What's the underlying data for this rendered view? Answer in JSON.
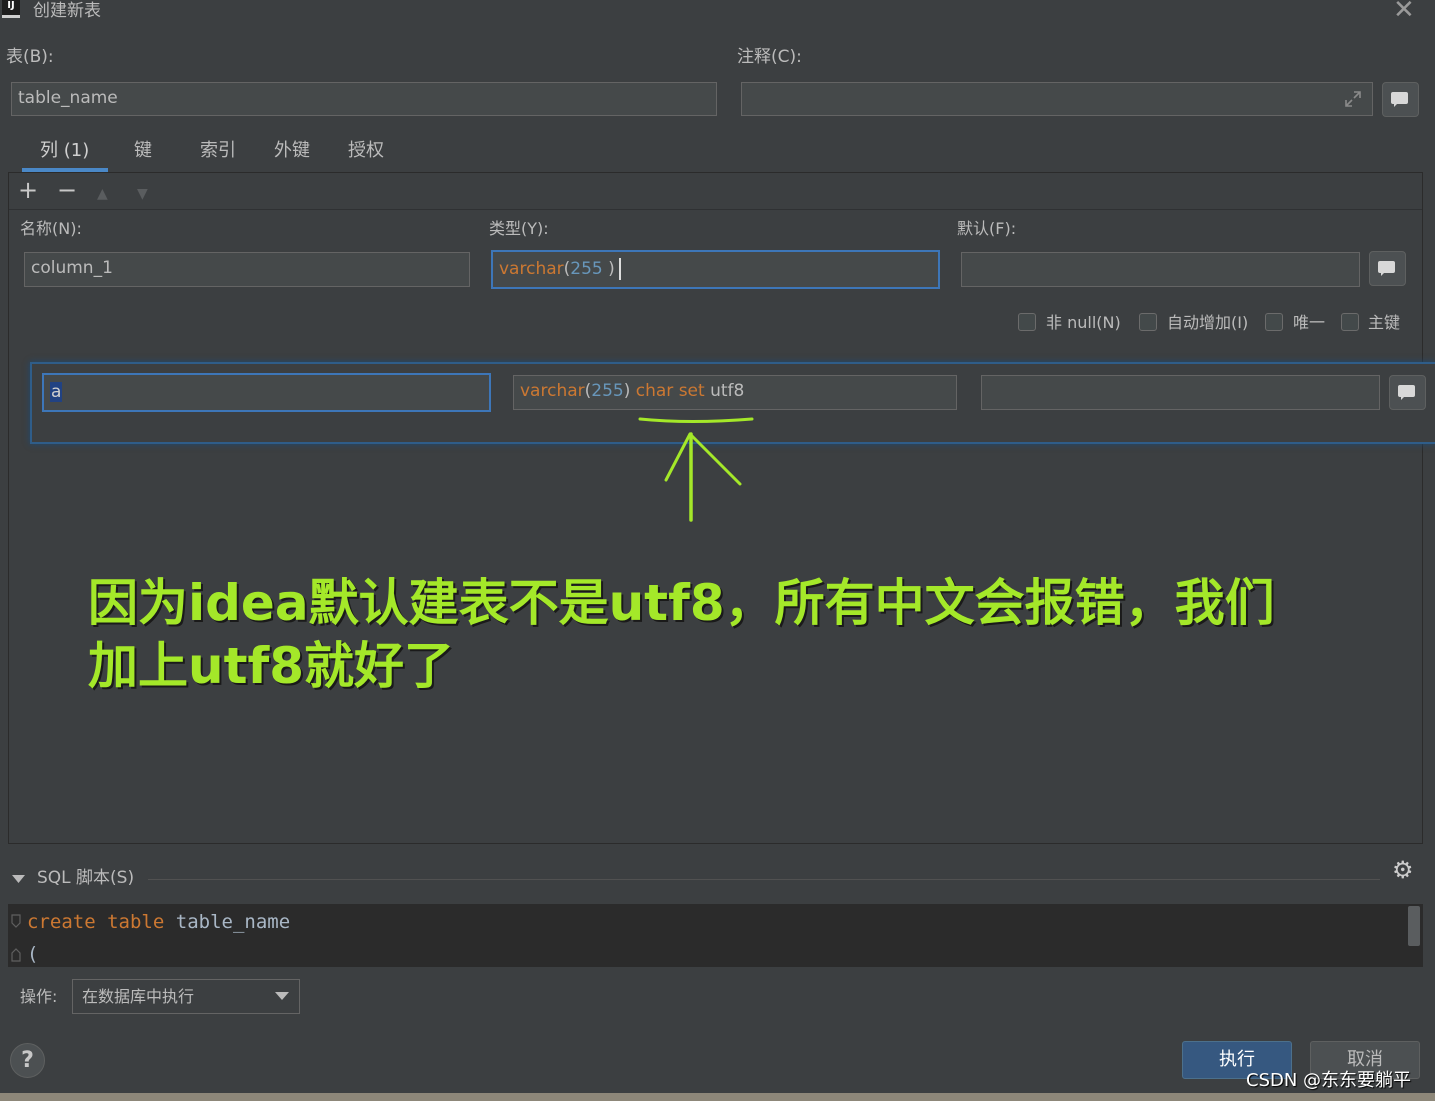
{
  "window": {
    "icon_text": "IJ",
    "title": "创建新表",
    "close": "✕"
  },
  "table": {
    "label": "表(B):",
    "value": "table_name"
  },
  "comment": {
    "label": "注释(C):",
    "value": ""
  },
  "tabs": [
    {
      "label": "列 (1)"
    },
    {
      "label": "键"
    },
    {
      "label": "索引"
    },
    {
      "label": "外键"
    },
    {
      "label": "授权"
    }
  ],
  "toolbar": {
    "add": "+",
    "remove": "−",
    "up": "▲",
    "down": "▼"
  },
  "column": {
    "name_label": "名称(N):",
    "name_value": "column_1",
    "type_label": "类型(Y):",
    "type_keyword": "varchar",
    "type_paren_open": "(",
    "type_num": "255",
    "type_paren_close": " )",
    "default_label": "默认(F):",
    "default_value": ""
  },
  "checkboxes": [
    {
      "label": "非 null(N)"
    },
    {
      "label": "自动增加(I)"
    },
    {
      "label": "唯一"
    },
    {
      "label": "主键"
    }
  ],
  "edit_row": {
    "name_value": "a",
    "type_keyword": "varchar",
    "type_paren_open": "(",
    "type_num": "255",
    "type_paren_close": ")",
    "type_charset": " char set",
    "type_charset_value": " utf8",
    "default_value": ""
  },
  "annotation": {
    "line1": "因为idea默认建表不是utf8，所有中文会报错，我们",
    "line2": "加上utf8就好了"
  },
  "sql": {
    "header": "SQL 脚本(S)",
    "line1_kw1": "create",
    "line1_kw2": "table",
    "line1_name": "table_name",
    "line2": "("
  },
  "operation": {
    "label": "操作:",
    "value": "在数据库中执行"
  },
  "buttons": {
    "help": "?",
    "execute": "执行",
    "cancel": "取消"
  },
  "watermark": "CSDN @东东要躺平",
  "colors": {
    "accent": "#4a88c7",
    "keyword": "#cc7832",
    "number": "#6897bb",
    "annotation": "#a4e829"
  }
}
